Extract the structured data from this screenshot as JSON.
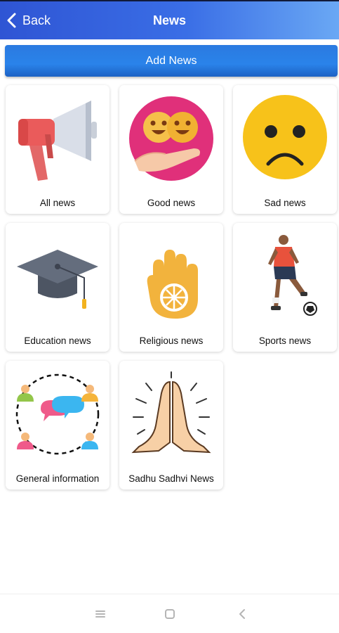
{
  "header": {
    "back_label": "Back",
    "title": "News"
  },
  "actions": {
    "add_news_label": "Add News"
  },
  "categories": [
    {
      "label": "All news",
      "icon": "megaphone-icon"
    },
    {
      "label": "Good news",
      "icon": "happy-faces-icon"
    },
    {
      "label": "Sad news",
      "icon": "sad-face-icon"
    },
    {
      "label": "Education news",
      "icon": "graduation-cap-icon"
    },
    {
      "label": "Religious news",
      "icon": "ahimsa-hand-icon"
    },
    {
      "label": "Sports news",
      "icon": "football-player-icon"
    },
    {
      "label": "General information",
      "icon": "people-chat-icon"
    },
    {
      "label": "Sadhu Sadhvi News",
      "icon": "namaste-hands-icon"
    }
  ],
  "system_nav": {
    "recents_icon": "recents-icon",
    "home_icon": "home-icon",
    "back_icon": "system-back-icon"
  },
  "colors": {
    "header_start": "#2f55d4",
    "header_end": "#6aa8f4",
    "button": "#2a83ea"
  }
}
